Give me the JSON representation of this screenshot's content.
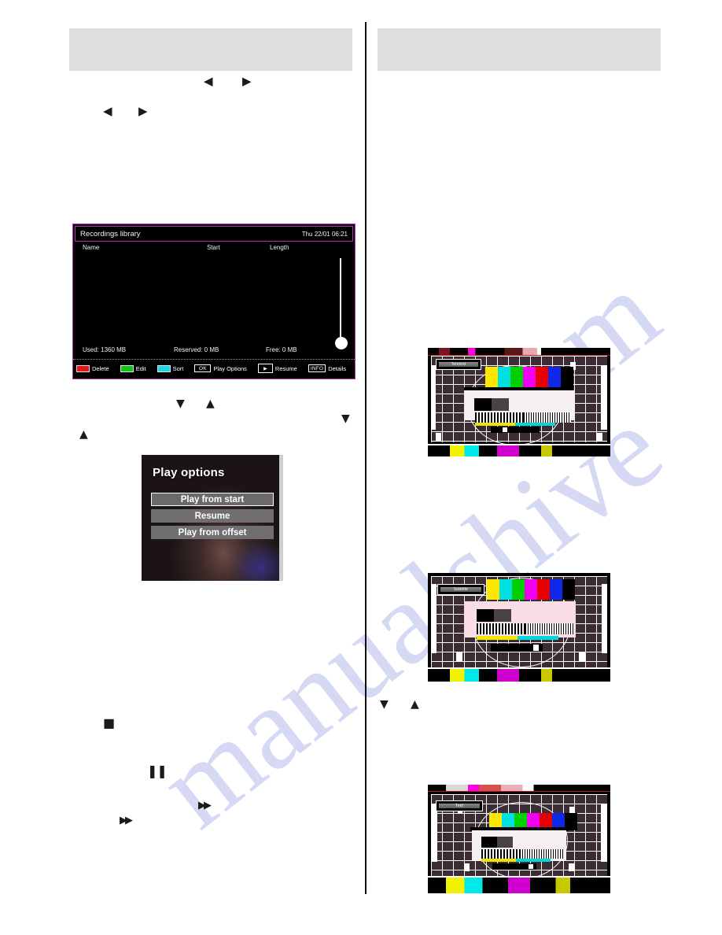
{
  "page": {
    "background": "#ffffff",
    "accent_magenta": "#b832b8",
    "watermark_text_left": "manualshive",
    "watermark_text_right": "com",
    "watermark_color": "#c9cdf0"
  },
  "left_column": {
    "redacted_header_bar": "",
    "nav_glyphs_row1": [
      "◀",
      "▶"
    ],
    "nav_glyphs_row2": [
      "◀",
      "▶"
    ],
    "nav_glyphs_row3": [
      "▼",
      "▲"
    ],
    "nav_glyphs_row4": [
      "▲"
    ],
    "nav_glyph_far_right": "▼",
    "media_glyph_stop": "■",
    "media_glyph_pause": "❚❚",
    "media_glyph_ff_upper": "▶▶",
    "media_glyph_ff_lower": "▶▶"
  },
  "right_column": {
    "redacted_header_bar": "",
    "nav_glyphs": [
      "▼",
      "▲"
    ]
  },
  "recordings_library": {
    "title": "Recordings library",
    "clock": "Thu 22/01 06:21",
    "columns": {
      "name": "Name",
      "start": "Start",
      "length": "Length"
    },
    "rows": [],
    "status": {
      "used": "Used: 1360 MB",
      "reserved": "Reserved: 0 MB",
      "free": "Free: 0 MB"
    },
    "actions": [
      {
        "key": "red",
        "key_label": "",
        "label": "Delete",
        "color": "#e8151d"
      },
      {
        "key": "green",
        "key_label": "",
        "label": "Edit",
        "color": "#12c21a"
      },
      {
        "key": "cyan",
        "key_label": "",
        "label": "Sort",
        "color": "#18d7e6"
      },
      {
        "key": "text",
        "key_label": "OK",
        "label": "Play Options",
        "color": "#000000"
      },
      {
        "key": "play",
        "key_label": "▶",
        "label": "Resume",
        "color": "#000000"
      },
      {
        "key": "text",
        "key_label": "INFO",
        "label": "Details",
        "color": "#000000"
      }
    ]
  },
  "play_options": {
    "title": "Play options",
    "items": [
      {
        "label": "Play from start",
        "selected": true
      },
      {
        "label": "Resume",
        "selected": false
      },
      {
        "label": "Play from offset",
        "selected": false
      }
    ]
  },
  "tv_screens": [
    {
      "badge": "Teletext",
      "caption": ""
    },
    {
      "badge": "Subtitle",
      "caption": ""
    },
    {
      "badge": "Text",
      "caption": ""
    }
  ]
}
